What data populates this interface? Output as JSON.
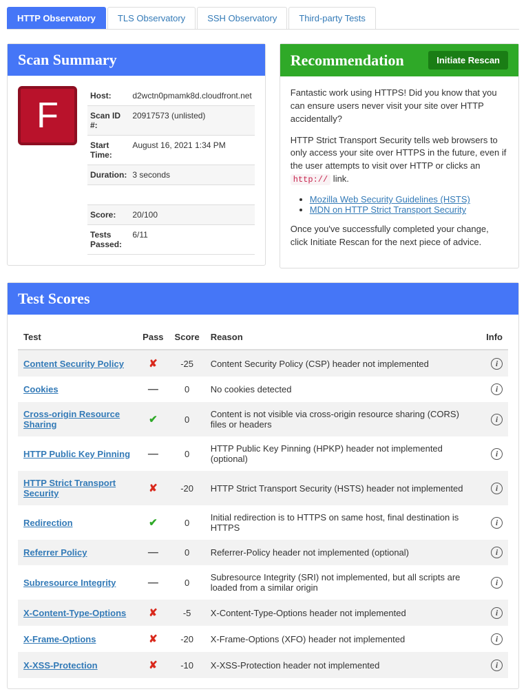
{
  "tabs": [
    "HTTP Observatory",
    "TLS Observatory",
    "SSH Observatory",
    "Third-party Tests"
  ],
  "summary": {
    "title": "Scan Summary",
    "grade": "F",
    "rows": [
      {
        "label": "Host:",
        "value": "d2wctn0pmamk8d.cloudfront.net"
      },
      {
        "label": "Scan ID #:",
        "value": "20917573 (unlisted)"
      },
      {
        "label": "Start Time:",
        "value": "August 16, 2021 1:34 PM"
      },
      {
        "label": "Duration:",
        "value": "3 seconds"
      },
      {
        "label": "",
        "value": ""
      },
      {
        "label": "Score:",
        "value": "20/100"
      },
      {
        "label": "Tests Passed:",
        "value": "6/11"
      }
    ]
  },
  "reco": {
    "title": "Recommendation",
    "rescan": "Initiate Rescan",
    "p1": "Fantastic work using HTTPS! Did you know that you can ensure users never visit your site over HTTP accidentally?",
    "p2a": "HTTP Strict Transport Security tells web browsers to only access your site over HTTPS in the future, even if the user attempts to visit over HTTP or clicks an ",
    "p2code": "http://",
    "p2b": " link.",
    "links": [
      "Mozilla Web Security Guidelines (HSTS)",
      "MDN on HTTP Strict Transport Security"
    ],
    "p3": "Once you've successfully completed your change, click Initiate Rescan for the next piece of advice."
  },
  "scores": {
    "title": "Test Scores",
    "headers": {
      "test": "Test",
      "pass": "Pass",
      "score": "Score",
      "reason": "Reason",
      "info": "Info"
    },
    "rows": [
      {
        "test": "Content Security Policy",
        "pass": "fail",
        "score": "-25",
        "reason": "Content Security Policy (CSP) header not implemented"
      },
      {
        "test": "Cookies",
        "pass": "dash",
        "score": "0",
        "reason": "No cookies detected"
      },
      {
        "test": "Cross-origin Resource Sharing",
        "pass": "pass",
        "score": "0",
        "reason": "Content is not visible via cross-origin resource sharing (CORS) files or headers"
      },
      {
        "test": "HTTP Public Key Pinning",
        "pass": "dash",
        "score": "0",
        "reason": "HTTP Public Key Pinning (HPKP) header not implemented (optional)"
      },
      {
        "test": "HTTP Strict Transport Security",
        "pass": "fail",
        "score": "-20",
        "reason": "HTTP Strict Transport Security (HSTS) header not implemented"
      },
      {
        "test": "Redirection",
        "pass": "pass",
        "score": "0",
        "reason": "Initial redirection is to HTTPS on same host, final destination is HTTPS"
      },
      {
        "test": "Referrer Policy",
        "pass": "dash",
        "score": "0",
        "reason": "Referrer-Policy header not implemented (optional)"
      },
      {
        "test": "Subresource Integrity",
        "pass": "dash",
        "score": "0",
        "reason": "Subresource Integrity (SRI) not implemented, but all scripts are loaded from a similar origin"
      },
      {
        "test": "X-Content-Type-Options",
        "pass": "fail",
        "score": "-5",
        "reason": "X-Content-Type-Options header not implemented"
      },
      {
        "test": "X-Frame-Options",
        "pass": "fail",
        "score": "-20",
        "reason": "X-Frame-Options (XFO) header not implemented"
      },
      {
        "test": "X-XSS-Protection",
        "pass": "fail",
        "score": "-10",
        "reason": "X-XSS-Protection header not implemented"
      }
    ]
  }
}
